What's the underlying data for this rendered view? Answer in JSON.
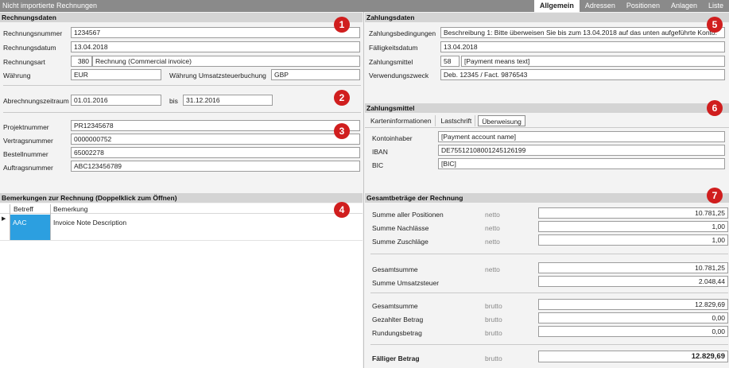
{
  "window": {
    "title": "Nicht importierte Rechnungen",
    "tabs": [
      "Allgemein",
      "Adressen",
      "Positionen",
      "Anlagen",
      "Liste"
    ],
    "active_tab": "Allgemein"
  },
  "rechnungsdaten": {
    "header": "Rechnungsdaten",
    "rechnungsnummer_label": "Rechnungsnummer",
    "rechnungsnummer": "1234567",
    "rechnungsdatum_label": "Rechnungsdatum",
    "rechnungsdatum": "13.04.2018",
    "rechnungsart_label": "Rechnungsart",
    "rechnungsart_code": "380",
    "rechnungsart_text": "Rechnung (Commercial invoice)",
    "waehrung_label": "Währung",
    "waehrung": "EUR",
    "waehrung_ust_label": "Währung Umsatzsteuerbuchung",
    "waehrung_ust": "GBP",
    "abrechnungszeitraum_label": "Abrechnungszeitraum",
    "von": "01.01.2016",
    "bis_label": "bis",
    "bis": "31.12.2016",
    "projektnummer_label": "Projektnummer",
    "projektnummer": "PR12345678",
    "vertragsnummer_label": "Vertragsnummer",
    "vertragsnummer": "0000000752",
    "bestellnummer_label": "Bestellnummer",
    "bestellnummer": "65002278",
    "auftragsnummer_label": "Auftragsnummer",
    "auftragsnummer": "ABC123456789"
  },
  "bemerkungen": {
    "header": "Bemerkungen zur Rechnung (Doppelklick zum Öffnen)",
    "col_betreff": "Betreff",
    "col_bemerkung": "Bemerkung",
    "rows": [
      {
        "betreff": "AAC",
        "bemerkung": "Invoice Note Description"
      }
    ]
  },
  "zahlungsdaten": {
    "header": "Zahlungsdaten",
    "bedingungen_label": "Zahlungsbedingungen",
    "bedingungen": "Beschreibung 1: Bitte überweisen Sie bis zum 13.04.2018 auf das unten aufgeführte Konto.",
    "faelligkeit_label": "Fälligkeitsdatum",
    "faelligkeit": "13.04.2018",
    "mittel_label": "Zahlungsmittel",
    "mittel_code": "58",
    "mittel_text": "[Payment means text]",
    "zweck_label": "Verwendungszweck",
    "zweck": "Deb. 12345 / Fact. 9876543"
  },
  "zahlungsmittel": {
    "header": "Zahlungsmittel",
    "tabs": [
      "Karteninformationen",
      "Lastschrift",
      "Überweisung"
    ],
    "active_tab": "Überweisung",
    "kontoinhaber_label": "Kontoinhaber",
    "kontoinhaber": "[Payment account name]",
    "iban_label": "IBAN",
    "iban": "DE75512108001245126199",
    "bic_label": "BIC",
    "bic": "[BIC]"
  },
  "gesamt": {
    "header": "Gesamtbeträge der Rechnung",
    "netto": "netto",
    "brutto": "brutto",
    "summe_positionen_label": "Summe aller Positionen",
    "summe_positionen": "10.781,25",
    "summe_nachlaesse_label": "Summe Nachlässe",
    "summe_nachlaesse": "1,00",
    "summe_zuschlaege_label": "Summe Zuschläge",
    "summe_zuschlaege": "1,00",
    "gesamtsumme_netto_label": "Gesamtsumme",
    "gesamtsumme_netto": "10.781,25",
    "summe_ust_label": "Summe Umsatzsteuer",
    "summe_ust": "2.048,44",
    "gesamtsumme_brutto_label": "Gesamtsumme",
    "gesamtsumme_brutto": "12.829,69",
    "gezahlt_label": "Gezahlter Betrag",
    "gezahlt": "0,00",
    "rundung_label": "Rundungsbetrag",
    "rundung": "0,00",
    "faellig_label": "Fälliger Betrag",
    "faellig": "12.829,69"
  },
  "badges": [
    "1",
    "2",
    "3",
    "4",
    "5",
    "6",
    "7"
  ],
  "colors": {
    "accent": "#d01e1e",
    "selection": "#2c9fe0",
    "header": "#d4d4d4",
    "titlebar": "#8a8a8a"
  }
}
